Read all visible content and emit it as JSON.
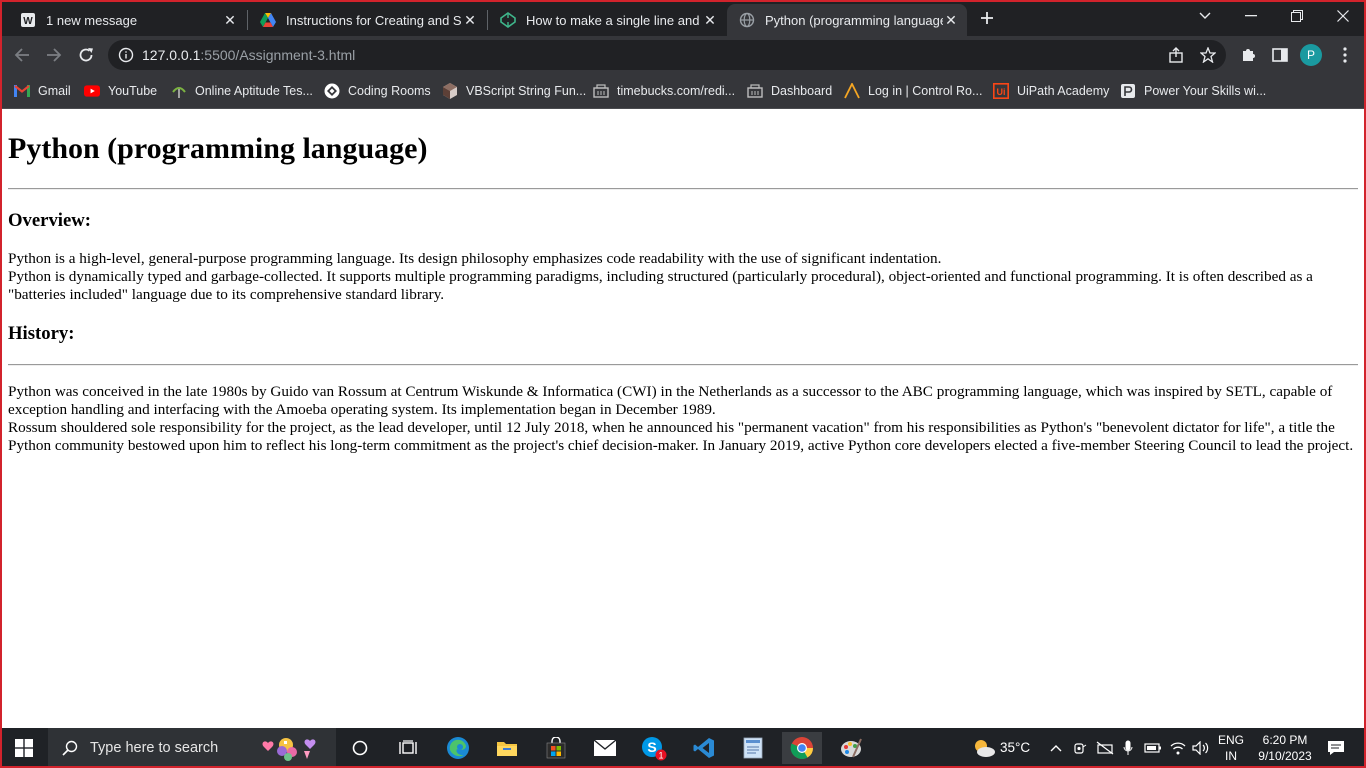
{
  "browser": {
    "tabs": [
      {
        "title": "1 new message",
        "icon": "wordpress-icon",
        "active": false
      },
      {
        "title": "Instructions for Creating and Sub",
        "icon": "google-drive-icon",
        "active": false
      },
      {
        "title": "How to make a single line and m",
        "icon": "codepen-icon",
        "active": false
      },
      {
        "title": "Python (programming language)",
        "icon": "globe-icon",
        "active": true
      }
    ],
    "url_host": "127.0.0.1",
    "url_path": ":5500/Assignment-3.html",
    "profile_initial": "P",
    "bookmarks": [
      {
        "label": "Gmail",
        "icon": "gmail-icon"
      },
      {
        "label": "YouTube",
        "icon": "youtube-icon"
      },
      {
        "label": "Online Aptitude Tes...",
        "icon": "aptitude-icon"
      },
      {
        "label": "Coding Rooms",
        "icon": "coding-rooms-icon"
      },
      {
        "label": "VBScript String Fun...",
        "icon": "vbscript-icon"
      },
      {
        "label": "timebucks.com/redi...",
        "icon": "timebucks-icon"
      },
      {
        "label": "Dashboard",
        "icon": "dashboard-icon"
      },
      {
        "label": "Log in | Control Ro...",
        "icon": "control-room-icon"
      },
      {
        "label": "UiPath Academy",
        "icon": "uipath-icon"
      },
      {
        "label": "Power Your Skills wi...",
        "icon": "power-skills-icon"
      }
    ]
  },
  "page": {
    "title": "Python (programming language)",
    "overview_heading": "Overview:",
    "overview_p1": "Python is a high-level, general-purpose programming language. Its design philosophy emphasizes code readability with the use of significant indentation.",
    "overview_p2": "Python is dynamically typed and garbage-collected. It supports multiple programming paradigms, including structured (particularly procedural), object-oriented and functional programming. It is often described as a \"batteries included\" language due to its comprehensive standard library.",
    "history_heading": "History:",
    "history_p1": "Python was conceived in the late 1980s by Guido van Rossum at Centrum Wiskunde & Informatica (CWI) in the Netherlands as a successor to the ABC programming language, which was inspired by SETL, capable of exception handling and interfacing with the Amoeba operating system. Its implementation began in December 1989.",
    "history_p2": "Rossum shouldered sole responsibility for the project, as the lead developer, until 12 July 2018, when he announced his \"permanent vacation\" from his responsibilities as Python's \"benevolent dictator for life\", a title the Python community bestowed upon him to reflect his long-term commitment as the project's chief decision-maker. In January 2019, active Python core developers elected a five-member Steering Council to lead the project."
  },
  "taskbar": {
    "search_placeholder": "Type here to search",
    "weather_temp": "35°C",
    "language_line1": "ENG",
    "language_line2": "IN",
    "time": "6:20 PM",
    "date": "9/10/2023",
    "skype_badge": "1"
  },
  "colors": {
    "chrome_dark": "#202124",
    "chrome_toolbar": "#35363a",
    "frame_red": "#d2232c",
    "taskbar": "#1f2226",
    "profile": "#1a9aa0"
  }
}
